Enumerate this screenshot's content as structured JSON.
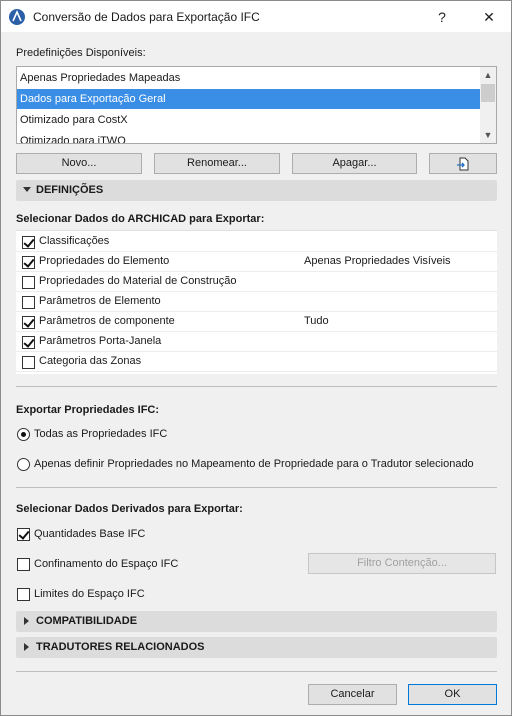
{
  "window": {
    "title": "Conversão de Dados para Exportação IFC",
    "help_glyph": "?",
    "close_glyph": "✕"
  },
  "presets": {
    "label": "Predefinições Disponíveis:",
    "items": [
      {
        "label": "Apenas Propriedades Mapeadas",
        "selected": false
      },
      {
        "label": "Dados para Exportação Geral",
        "selected": true
      },
      {
        "label": "Otimizado para CostX",
        "selected": false
      },
      {
        "label": "Otimizado para iTWO",
        "selected": false
      }
    ],
    "buttons": {
      "new": "Novo...",
      "rename": "Renomear...",
      "delete": "Apagar..."
    }
  },
  "definitions": {
    "header": "DEFINIÇÕES",
    "archicad_label": "Selecionar Dados do ARCHICAD para Exportar:",
    "archicad_items": [
      {
        "label": "Classificações",
        "checked": true,
        "value": ""
      },
      {
        "label": "Propriedades do Elemento",
        "checked": true,
        "value": "Apenas Propriedades Visíveis"
      },
      {
        "label": "Propriedades do Material de Construção",
        "checked": false,
        "value": ""
      },
      {
        "label": "Parâmetros de Elemento",
        "checked": false,
        "value": ""
      },
      {
        "label": "Parâmetros de componente",
        "checked": true,
        "value": "Tudo"
      },
      {
        "label": "Parâmetros Porta-Janela",
        "checked": true,
        "value": ""
      },
      {
        "label": "Categoria das Zonas",
        "checked": false,
        "value": ""
      }
    ],
    "ifc_props_label": "Exportar Propriedades IFC:",
    "ifc_props_options": [
      {
        "label": "Todas as Propriedades IFC",
        "selected": true
      },
      {
        "label": "Apenas definir Propriedades no Mapeamento de Propriedade para o Tradutor selecionado",
        "selected": false
      }
    ],
    "derived_label": "Selecionar Dados Derivados para Exportar:",
    "derived_items": [
      {
        "label": "Quantidades Base IFC",
        "checked": true
      },
      {
        "label": "Confinamento do Espaço IFC",
        "checked": false
      },
      {
        "label": "Limites do Espaço IFC",
        "checked": false
      }
    ],
    "containment_filter_button": "Filtro Contenção..."
  },
  "compatibility": {
    "header": "COMPATIBILIDADE"
  },
  "related_translators": {
    "header": "TRADUTORES RELACIONADOS"
  },
  "footer": {
    "cancel": "Cancelar",
    "ok": "OK"
  }
}
